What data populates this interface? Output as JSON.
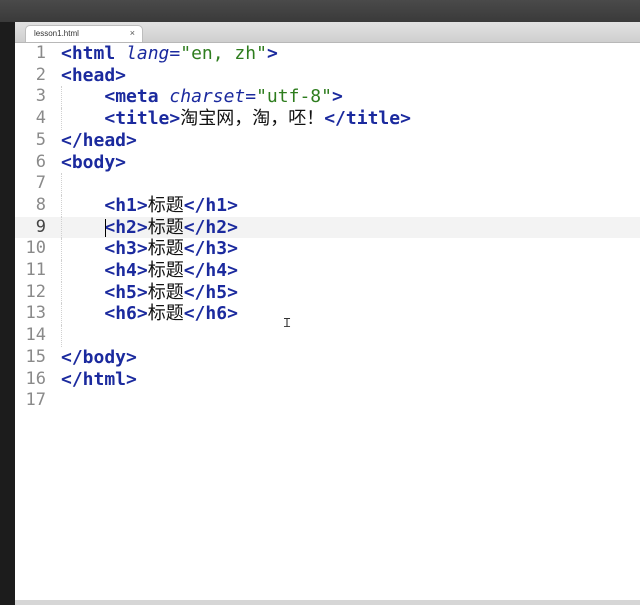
{
  "tab": {
    "label": "lesson1.html",
    "close": "×"
  },
  "lines": [
    {
      "n": "1",
      "tokens": [
        {
          "c": "tag",
          "t": "<html"
        },
        {
          "c": "txt",
          "t": " "
        },
        {
          "c": "attr",
          "t": "lang"
        },
        {
          "c": "sym",
          "t": "="
        },
        {
          "c": "val",
          "t": "\"en, zh\""
        },
        {
          "c": "tag",
          "t": ">"
        }
      ]
    },
    {
      "n": "2",
      "tokens": [
        {
          "c": "tag",
          "t": "<head>"
        }
      ]
    },
    {
      "n": "3",
      "tokens": [
        {
          "c": "txt",
          "t": "    "
        },
        {
          "c": "tag",
          "t": "<meta"
        },
        {
          "c": "txt",
          "t": " "
        },
        {
          "c": "attr",
          "t": "charset"
        },
        {
          "c": "sym",
          "t": "="
        },
        {
          "c": "val",
          "t": "\"utf-8\""
        },
        {
          "c": "tag",
          "t": ">"
        }
      ]
    },
    {
      "n": "4",
      "tokens": [
        {
          "c": "txt",
          "t": "    "
        },
        {
          "c": "tag",
          "t": "<title>"
        },
        {
          "c": "txt",
          "t": "淘宝网，淘，呸！"
        },
        {
          "c": "tag",
          "t": "</title>"
        }
      ]
    },
    {
      "n": "5",
      "tokens": [
        {
          "c": "tag",
          "t": "</head>"
        }
      ]
    },
    {
      "n": "6",
      "tokens": [
        {
          "c": "tag",
          "t": "<body>"
        }
      ]
    },
    {
      "n": "7",
      "tokens": []
    },
    {
      "n": "8",
      "tokens": [
        {
          "c": "txt",
          "t": "    "
        },
        {
          "c": "tag",
          "t": "<h1>"
        },
        {
          "c": "txt",
          "t": "标题"
        },
        {
          "c": "tag",
          "t": "</h1>"
        }
      ]
    },
    {
      "n": "9",
      "tokens": [
        {
          "c": "txt",
          "t": "    "
        },
        {
          "c": "tag",
          "t": "<h2>"
        },
        {
          "c": "txt",
          "t": "标题"
        },
        {
          "c": "tag",
          "t": "</h2>"
        }
      ],
      "current": true
    },
    {
      "n": "10",
      "tokens": [
        {
          "c": "txt",
          "t": "    "
        },
        {
          "c": "tag",
          "t": "<h3>"
        },
        {
          "c": "txt",
          "t": "标题"
        },
        {
          "c": "tag",
          "t": "</h3>"
        }
      ]
    },
    {
      "n": "11",
      "tokens": [
        {
          "c": "txt",
          "t": "    "
        },
        {
          "c": "tag",
          "t": "<h4>"
        },
        {
          "c": "txt",
          "t": "标题"
        },
        {
          "c": "tag",
          "t": "</h4>"
        }
      ]
    },
    {
      "n": "12",
      "tokens": [
        {
          "c": "txt",
          "t": "    "
        },
        {
          "c": "tag",
          "t": "<h5>"
        },
        {
          "c": "txt",
          "t": "标题"
        },
        {
          "c": "tag",
          "t": "</h5>"
        }
      ]
    },
    {
      "n": "13",
      "tokens": [
        {
          "c": "txt",
          "t": "    "
        },
        {
          "c": "tag",
          "t": "<h6>"
        },
        {
          "c": "txt",
          "t": "标题"
        },
        {
          "c": "tag",
          "t": "</h6>"
        }
      ]
    },
    {
      "n": "14",
      "tokens": []
    },
    {
      "n": "15",
      "tokens": [
        {
          "c": "tag",
          "t": "</body>"
        }
      ]
    },
    {
      "n": "16",
      "tokens": [
        {
          "c": "tag",
          "t": "</html>"
        }
      ]
    },
    {
      "n": "17",
      "tokens": []
    }
  ],
  "colors": {
    "tag": "#1b2a9e",
    "value": "#2e7d1e",
    "gutter_text": "#8a8a8a"
  },
  "icons": {
    "mouse_cursor": "ibeam-cursor-icon"
  }
}
